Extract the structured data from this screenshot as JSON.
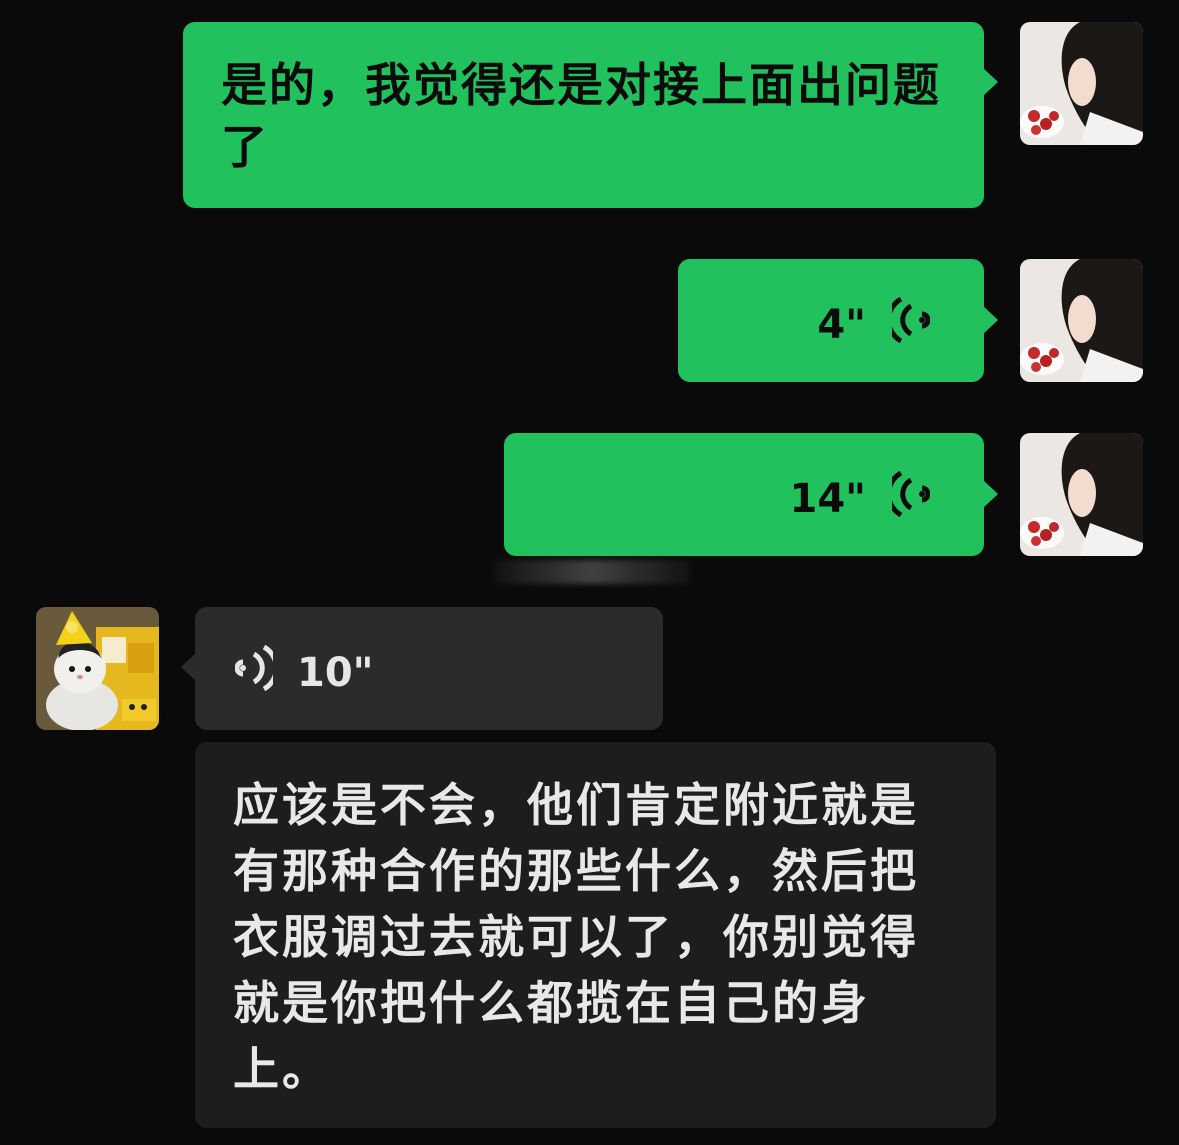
{
  "messages": [
    {
      "sender": "me",
      "type": "text",
      "text": "是的，我觉得还是对接上面出问题了"
    },
    {
      "sender": "me",
      "type": "voice",
      "duration": "4\""
    },
    {
      "sender": "me",
      "type": "voice",
      "duration": "14\""
    },
    {
      "sender": "other",
      "type": "voice",
      "duration": "10\""
    },
    {
      "sender": "other",
      "type": "text",
      "text": "应该是不会，他们肯定附近就是有那种合作的那些什么，然后把衣服调过去就可以了，你别觉得就是你把什么都揽在自己的身上。"
    }
  ],
  "colors": {
    "background": "#0a0a0a",
    "my_bubble": "#21c25e",
    "their_bubble": "#2b2b2b"
  },
  "icons": {
    "voice_icon": "voice-wave-icon"
  }
}
